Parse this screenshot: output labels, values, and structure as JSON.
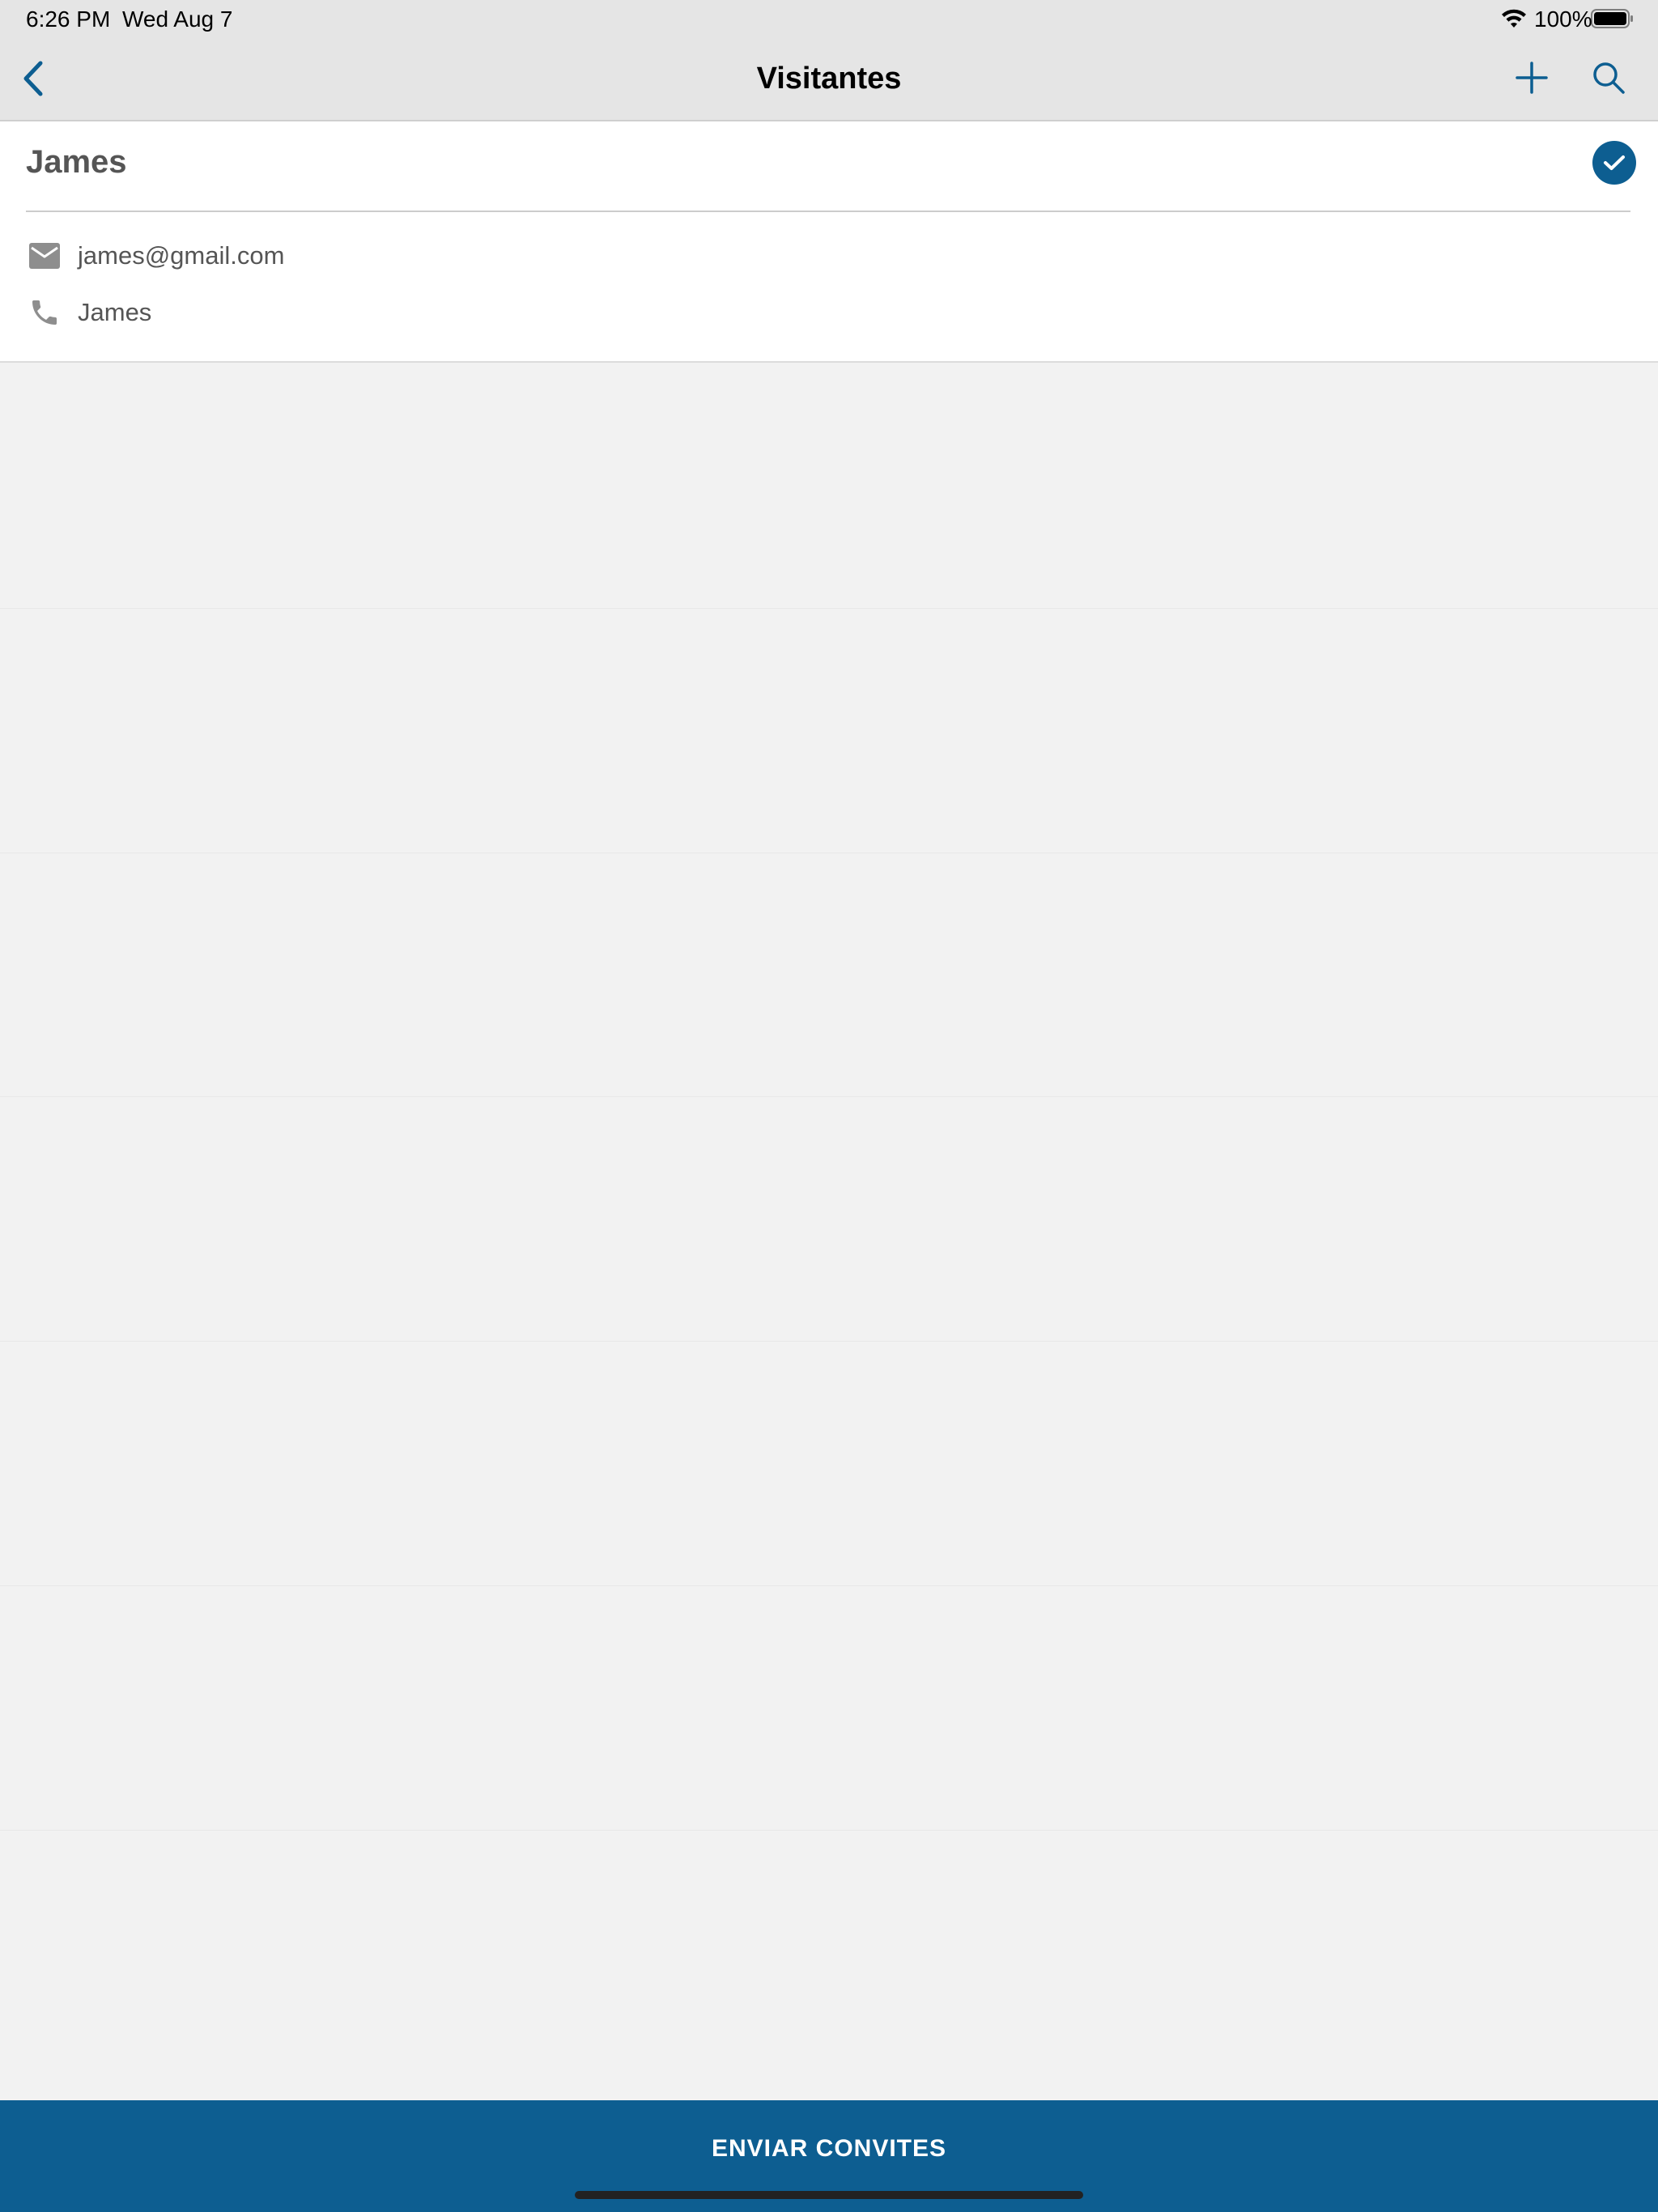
{
  "status_bar": {
    "time": "6:26 PM",
    "date": "Wed Aug 7",
    "battery": "100%",
    "icons": [
      "wifi-icon",
      "battery-icon"
    ]
  },
  "nav": {
    "title": "Visitantes",
    "icons": [
      "chevron-left-icon",
      "plus-icon",
      "search-icon"
    ]
  },
  "visitor": {
    "name": "James",
    "selected": true,
    "email": "james@gmail.com",
    "phone": "James",
    "icons": [
      "check-icon",
      "mail-icon",
      "phone-icon"
    ]
  },
  "actions": {
    "send_label": "ENVIAR CONVITES"
  },
  "colors": {
    "accent": "#0d5e91",
    "header_bg": "#e5e5e5",
    "page_bg": "#f2f2f2"
  }
}
